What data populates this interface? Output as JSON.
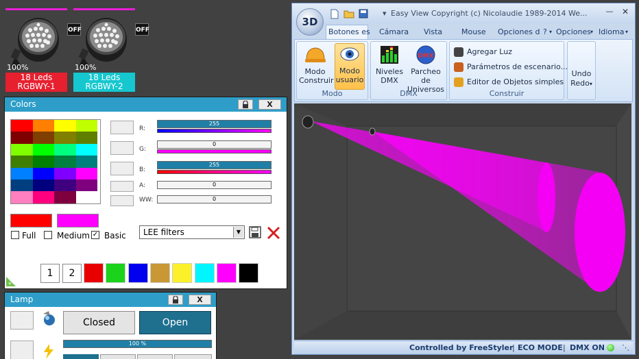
{
  "fixtures": [
    {
      "percent": "100%",
      "name_line1": "18 Leds",
      "name_line2": "RGBWY-1",
      "state": "OFF",
      "color": "#e6202f"
    },
    {
      "percent": "100%",
      "name_line1": "18 Leds",
      "name_line2": "RGBWY-2",
      "state": "OFF",
      "color": "#16c7cf"
    }
  ],
  "colors_panel": {
    "title": "Colors",
    "lock_icon": "lock-icon",
    "close_label": "X",
    "grid": [
      [
        "#ff0000",
        "#ff7f00",
        "#ffff00",
        "#c0ff00"
      ],
      [
        "#7f0000",
        "#7f3f00",
        "#7f7f00",
        "#5f7f00"
      ],
      [
        "#7fff00",
        "#00ff00",
        "#00ff7f",
        "#00ffff"
      ],
      [
        "#3f7f00",
        "#007f00",
        "#007f3f",
        "#007f7f"
      ],
      [
        "#007fff",
        "#0000ff",
        "#7f00ff",
        "#ff00ff"
      ],
      [
        "#003f7f",
        "#00007f",
        "#3f007f",
        "#7f007f"
      ],
      [
        "#ff7fbf",
        "#ff007f",
        "#7f003f",
        "#ffffff"
      ]
    ],
    "channels": [
      {
        "label": "R:",
        "value": "255",
        "level": 1.0,
        "under": "linear-gradient(90deg,#0000ff,#ff00ff)"
      },
      {
        "label": "G:",
        "value": "0",
        "level": 0.0,
        "under": "linear-gradient(90deg,#ff00ff,#ff00ff)"
      },
      {
        "label": "B:",
        "value": "255",
        "level": 1.0,
        "under": "linear-gradient(90deg,#ff0000,#ff00ff)"
      },
      {
        "label": "A:",
        "value": "0",
        "level": 0.0,
        "under": ""
      },
      {
        "label": "WW:",
        "value": "0",
        "level": 0.0,
        "under": ""
      }
    ],
    "preview_left": "#ff0000",
    "preview_right": "#ff00ff",
    "modes": [
      {
        "label": "Full",
        "checked": false
      },
      {
        "label": "Medium",
        "checked": false
      },
      {
        "label": "Basic",
        "checked": true
      }
    ],
    "filter_select": "LEE filters",
    "save_icon": "floppy-disk-icon",
    "delete_icon": "red-x-icon",
    "pages": [
      "1",
      "2"
    ],
    "quick_colors": [
      "#e80000",
      "#1ad31a",
      "#0000ee",
      "#c99733",
      "#fbf02a",
      "#00f5ff",
      "#ff00ff",
      "#000000"
    ]
  },
  "lamp_panel": {
    "title": "Lamp",
    "close_label": "X",
    "closed_label": "Closed",
    "open_label": "Open",
    "dimmer_value": "100 %",
    "dimmer_level": 1.0
  },
  "window": {
    "title": "Easy View   Copyright (c) Nicolaudie 1989-2014   We...",
    "logo": "3D",
    "tabs": [
      "Botones es",
      "Cámara",
      "Vista",
      "Mouse",
      "Opciones d",
      "?",
      "Opciones",
      "Idioma"
    ],
    "groups": {
      "modo": {
        "label": "Modo",
        "construir": [
          "Modo",
          "Construir"
        ],
        "usuario": [
          "Modo",
          "usuario"
        ]
      },
      "dmx": {
        "label": "DMX",
        "niveles": [
          "Niveles",
          "DMX"
        ],
        "parcheo": [
          "Parcheo de",
          "Universos"
        ]
      },
      "construir": {
        "label": "Construir",
        "items": [
          "Agregar Luz",
          "Parámetros de escenario...",
          "Editor de Objetos simples"
        ]
      },
      "undo": {
        "label1": "Undo",
        "label2": "Redo"
      }
    },
    "status": {
      "controlled": "Controlled by FreeStyler",
      "eco": "ECO MODE",
      "dmx": "DMX ON"
    }
  }
}
